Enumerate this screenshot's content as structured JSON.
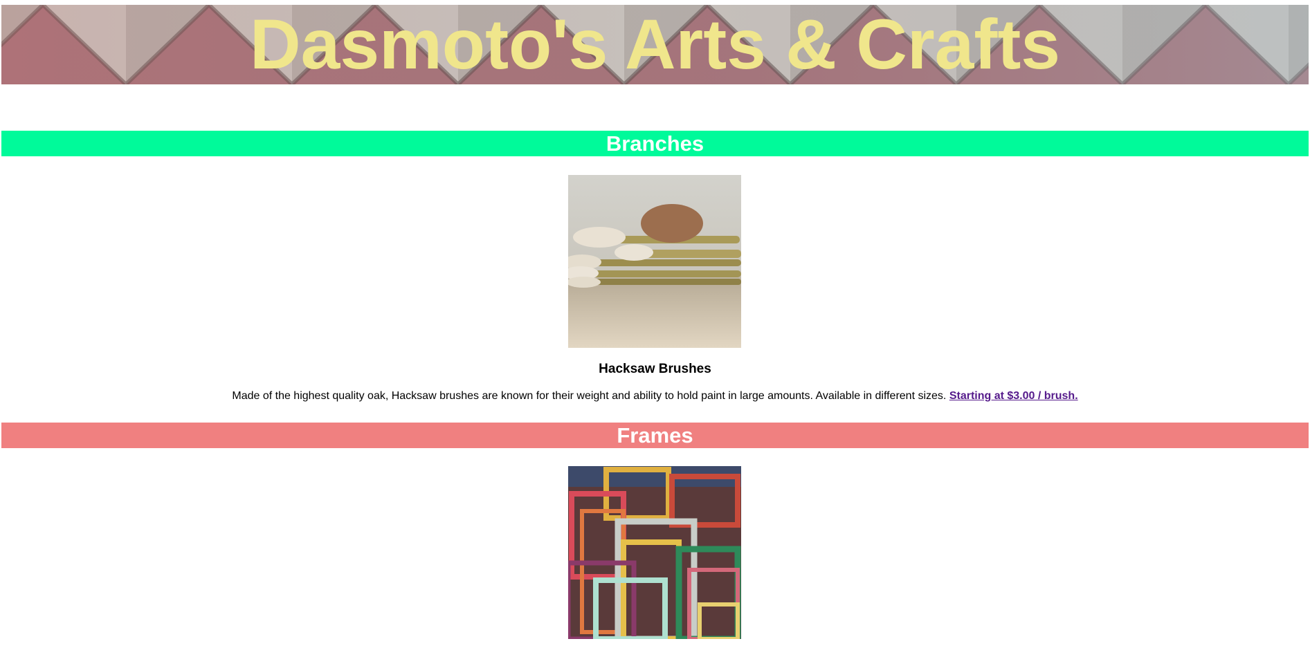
{
  "header": {
    "title": "Dasmoto's Arts & Crafts",
    "title_color": "#f0e68c"
  },
  "sections": [
    {
      "heading": "Branches",
      "background": "#00fa9a",
      "product": {
        "image_alt": "Hacksaw Brushes",
        "name": "Hacksaw Brushes",
        "description": "Made of the highest quality oak, Hacksaw brushes are known for their weight and ability to hold paint in large amounts. Available in different sizes.",
        "price_link": "Starting at $3.00 / brush."
      }
    },
    {
      "heading": "Frames",
      "background": "#f08080",
      "product": {
        "image_alt": "Frames"
      }
    }
  ],
  "colors": {
    "link_visited": "#551a8b",
    "heading_text": "#ffffff"
  }
}
